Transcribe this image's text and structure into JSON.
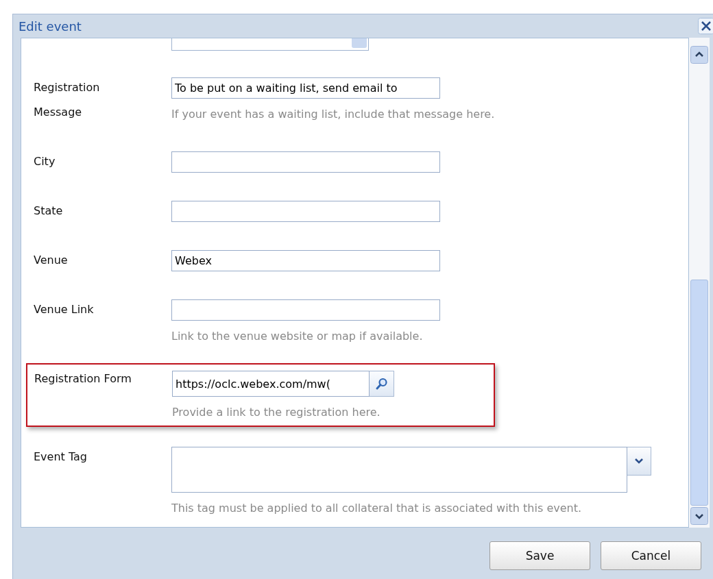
{
  "window": {
    "title": "Edit event"
  },
  "fields": [
    {
      "kind": "text",
      "label": "Registration Message",
      "value": "To be put on a waiting list, send email to",
      "hint": "If your event has a waiting list, include that message here.",
      "highlighted": false
    },
    {
      "kind": "text",
      "label": "City",
      "highlighted": false
    },
    {
      "kind": "text",
      "label": "State",
      "highlighted": false
    },
    {
      "kind": "text",
      "label": "Venue",
      "value": "Webex",
      "highlighted": false
    },
    {
      "kind": "text",
      "label": "Venue Link",
      "hint": "Link to the venue website or map if available.",
      "highlighted": false
    },
    {
      "kind": "lookup",
      "label": "Registration Form",
      "value": "https://oclc.webex.com/mw(",
      "hint": "Provide a link to the registration here.",
      "highlighted": true
    },
    {
      "kind": "tag",
      "label": "Event Tag",
      "hint": "This tag must be applied to all collateral that is associated with this event.",
      "highlighted": false
    }
  ],
  "buttons": [
    "Save",
    "Cancel"
  ]
}
